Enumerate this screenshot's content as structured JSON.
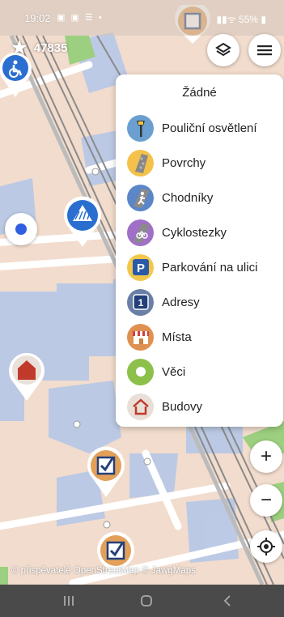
{
  "status_bar": {
    "time": "19:02",
    "notification_icons": "▣ ▣ ☰ •",
    "battery": "55%"
  },
  "map": {
    "star_count": "47835",
    "attribution": "© přispěvatelé OpenStreetMap © JawgMaps"
  },
  "overlay_menu": {
    "title": "Žádné",
    "items": [
      {
        "label": "Pouliční osvětlení",
        "icon": "street-lamp-icon",
        "color": "#6a9fd0"
      },
      {
        "label": "Povrchy",
        "icon": "surface-icon",
        "color": "#f4c24a"
      },
      {
        "label": "Chodníky",
        "icon": "pedestrian-icon",
        "color": "#5b86c8"
      },
      {
        "label": "Cyklostezky",
        "icon": "bicycle-icon",
        "color": "#a070c8"
      },
      {
        "label": "Parkování na ulici",
        "icon": "parking-icon",
        "color": "#f2c84a"
      },
      {
        "label": "Adresy",
        "icon": "address-icon",
        "color": "#6a7fa6"
      },
      {
        "label": "Místa",
        "icon": "shop-icon",
        "color": "#e09050"
      },
      {
        "label": "Věci",
        "icon": "things-icon",
        "color": "#8cc04a"
      },
      {
        "label": "Budovy",
        "icon": "building-icon",
        "color": "#e8e0d8"
      }
    ]
  },
  "zoom": {
    "in": "+",
    "out": "−"
  },
  "colors": {
    "map_bg": "#f2dccd",
    "block": "#b9c8e6",
    "road": "#ffffff",
    "green": "#9ccf7f"
  }
}
